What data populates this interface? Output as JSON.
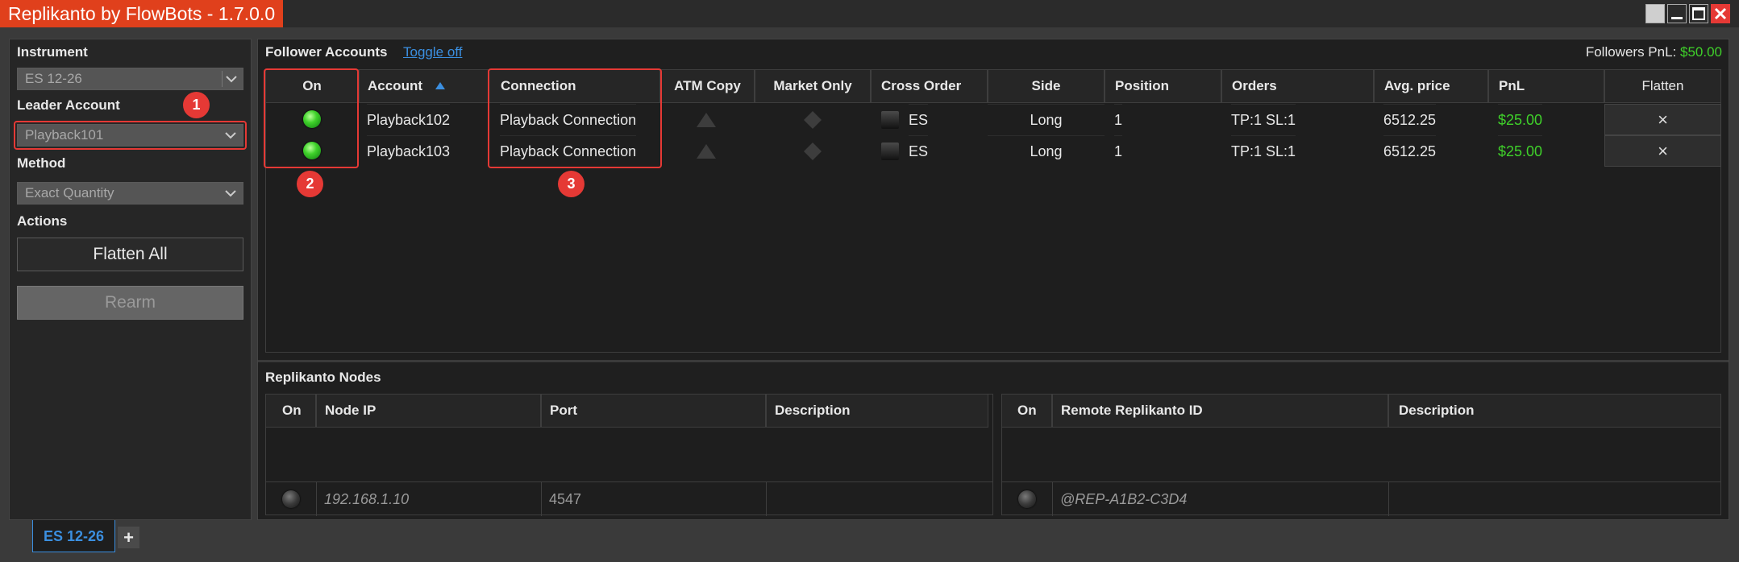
{
  "window": {
    "title": "Replikanto by FlowBots - 1.7.0.0"
  },
  "left": {
    "instrument_label": "Instrument",
    "instrument_value": "ES 12-26",
    "leader_label": "Leader Account",
    "leader_value": "Playback101",
    "method_label": "Method",
    "method_value": "Exact Quantity",
    "actions_label": "Actions",
    "flatten_all_label": "Flatten All",
    "rearm_label": "Rearm"
  },
  "followers": {
    "title": "Follower Accounts",
    "toggle_label": "Toggle off",
    "pnl_label": "Followers PnL:",
    "pnl_value": "$50.00",
    "columns": [
      "On",
      "Account",
      "Connection",
      "ATM Copy",
      "Market Only",
      "Cross Order",
      "Side",
      "Position",
      "Orders",
      "Avg. price",
      "PnL",
      "Flatten"
    ],
    "rows": [
      {
        "on": true,
        "account": "Playback102",
        "connection": "Playback Connection",
        "cross": "ES",
        "side": "Long",
        "position": "1",
        "orders": "TP:1 SL:1",
        "avg": "6512.25",
        "pnl": "$25.00",
        "flatten": "×"
      },
      {
        "on": true,
        "account": "Playback103",
        "connection": "Playback Connection",
        "cross": "ES",
        "side": "Long",
        "position": "1",
        "orders": "TP:1 SL:1",
        "avg": "6512.25",
        "pnl": "$25.00",
        "flatten": "×"
      }
    ]
  },
  "nodes": {
    "title": "Replikanto Nodes",
    "left_columns": [
      "On",
      "Node IP",
      "Port",
      "Description"
    ],
    "left_row": {
      "ip": "192.168.1.10",
      "port": "4547",
      "description": ""
    },
    "right_columns": [
      "On",
      "Remote Replikanto ID",
      "Description"
    ],
    "right_row": {
      "remote_id": "@REP-A1B2-C3D4",
      "description": ""
    }
  },
  "annotations": [
    "1",
    "2",
    "3"
  ],
  "tabs": {
    "active": "ES 12-26",
    "add": "+"
  },
  "colors": {
    "accent": "#e0401c",
    "link": "#3b8fe0",
    "positive": "#3fd12a",
    "annotation": "#e53935"
  }
}
